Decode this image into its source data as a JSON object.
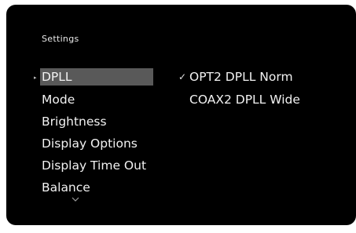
{
  "menu": {
    "title": "Settings",
    "items": [
      {
        "label": "DPLL"
      },
      {
        "label": "Mode"
      },
      {
        "label": "Brightness"
      },
      {
        "label": "Display Options"
      },
      {
        "label": "Display Time Out"
      },
      {
        "label": "Balance"
      }
    ],
    "selected_index": 0,
    "pointer_icon": "triangle-right-icon",
    "more_icon": "chevron-down-icon"
  },
  "options": {
    "items": [
      {
        "label": "OPT2 DPLL Norm",
        "checked": true
      },
      {
        "label": "COAX2 DPLL Wide",
        "checked": false
      }
    ],
    "check_icon": "checkmark-icon"
  },
  "colors": {
    "background": "#000000",
    "highlight": "#595959",
    "text": "#f2f2f2"
  }
}
